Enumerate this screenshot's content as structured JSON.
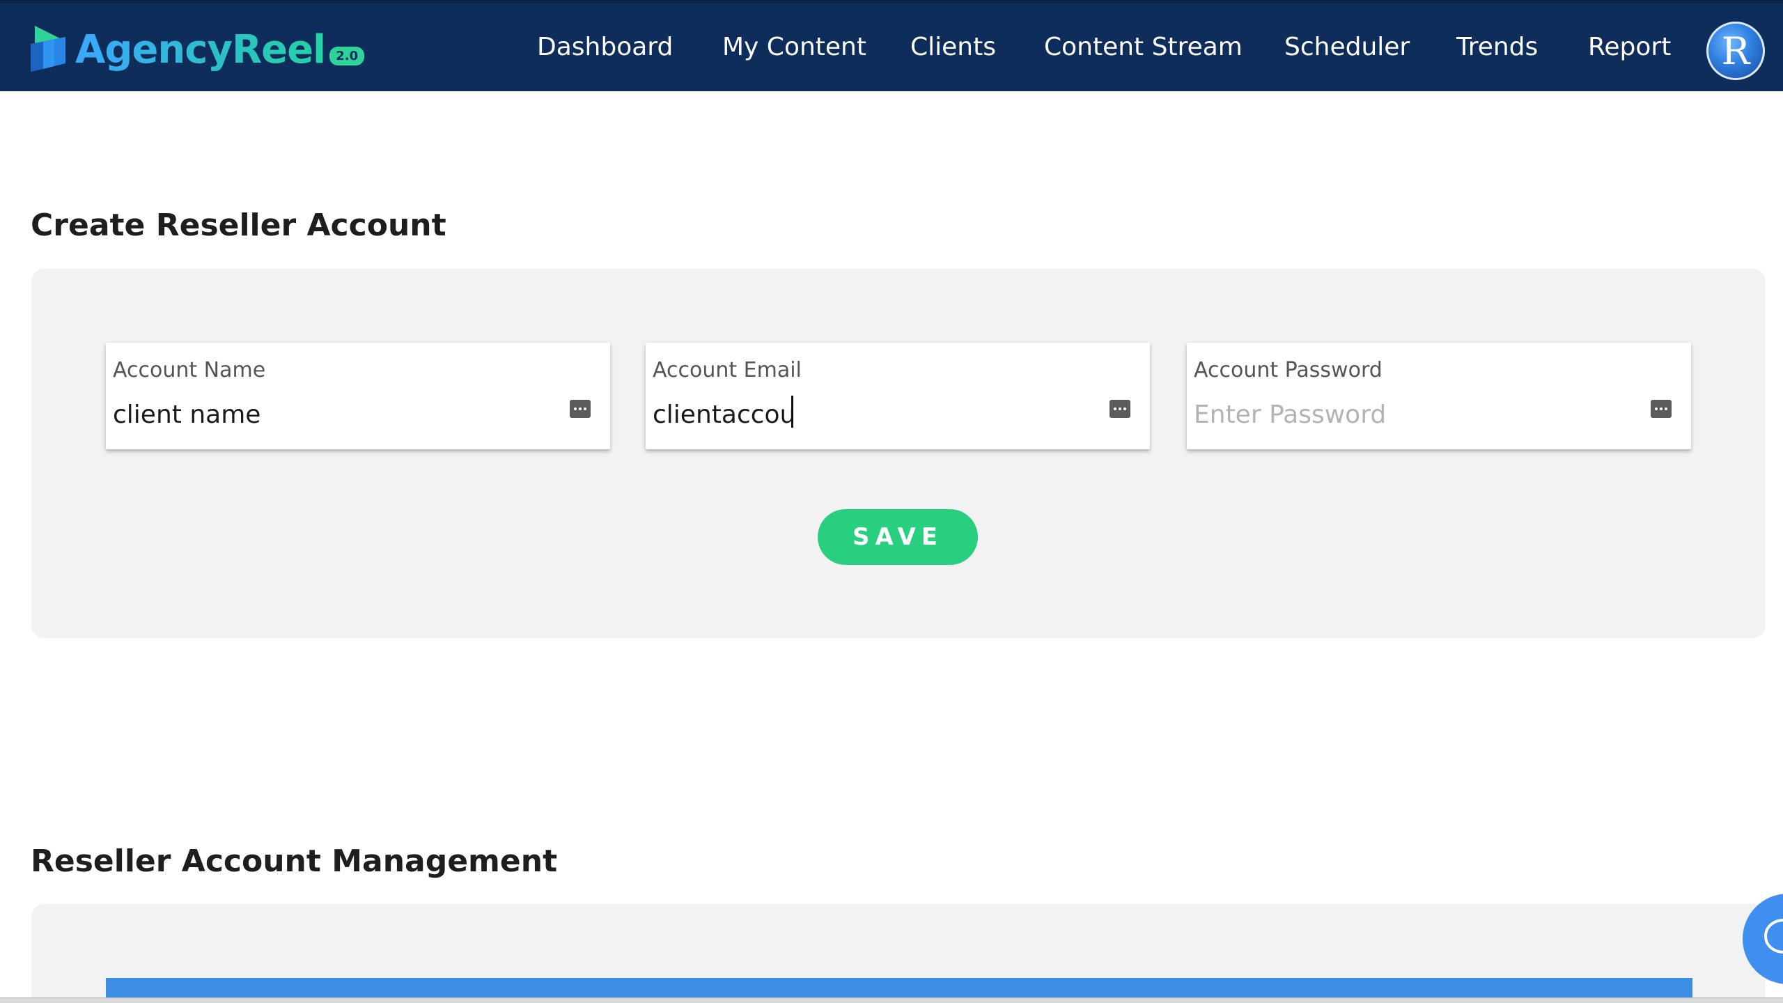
{
  "brand": {
    "name": "AgencyReel",
    "version": "2.0"
  },
  "nav": {
    "items": [
      {
        "label": "Dashboard"
      },
      {
        "label": "My Content"
      },
      {
        "label": "Clients"
      },
      {
        "label": "Content Stream"
      },
      {
        "label": "Scheduler"
      },
      {
        "label": "Trends"
      },
      {
        "label": "Report"
      }
    ],
    "avatar_letter": "R"
  },
  "create_section": {
    "title": "Create Reseller Account",
    "fields": {
      "name": {
        "label": "Account Name",
        "value": "client name",
        "placeholder": ""
      },
      "email": {
        "label": "Account Email",
        "value": "clientaccou",
        "placeholder": ""
      },
      "password": {
        "label": "Account Password",
        "value": "",
        "placeholder": "Enter Password"
      }
    },
    "save_label": "SAVE"
  },
  "management_section": {
    "title": "Reseller Account Management"
  },
  "colors": {
    "nav_bg": "#0f2d5a",
    "accent_green": "#27cf7f",
    "panel_bg": "#f2f2f2",
    "table_header": "#3d8fe6",
    "chat_blue": "#3f8ff0"
  },
  "icons": {
    "logo": "agencyreel-logo-icon",
    "field_action": "more-dots-icon",
    "chat": "chat-bubble-icon"
  }
}
